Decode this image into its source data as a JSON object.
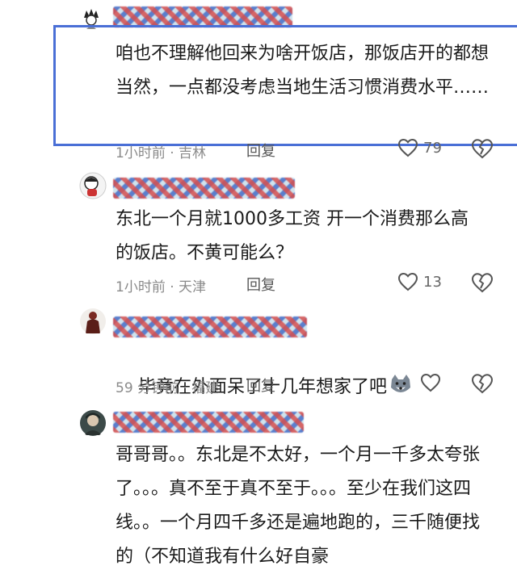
{
  "comments": [
    {
      "text": "咱也不理解他回来为啥开饭店，那饭店开的都想当然，一点都没考虑当地生活习惯消费水平……",
      "meta": "1小时前 · 吉林",
      "reply": "回复",
      "likes": "79"
    },
    {
      "text": "东北一个月就1000多工资 开一个消费那么高的饭店。不黄可能么？",
      "meta": "1小时前 · 天津",
      "reply": "回复",
      "likes": "13"
    },
    {
      "text": "毕竟在外面呆了十几年想家了吧",
      "meta": "59 分钟前 · 福建",
      "reply": "回复",
      "likes": ""
    },
    {
      "text": "哥哥哥。。东北是不太好，一个月一千多太夸张了。。。真不至于真不至于。。。至少在我们这四线。。一个月四千多还是遍地跑的，三千随便找的（不知道我有什么好自豪"
    }
  ],
  "colors": {
    "highlight": "#4a6fd6",
    "text": "#1a1a1a",
    "meta": "#8a8a8a"
  }
}
